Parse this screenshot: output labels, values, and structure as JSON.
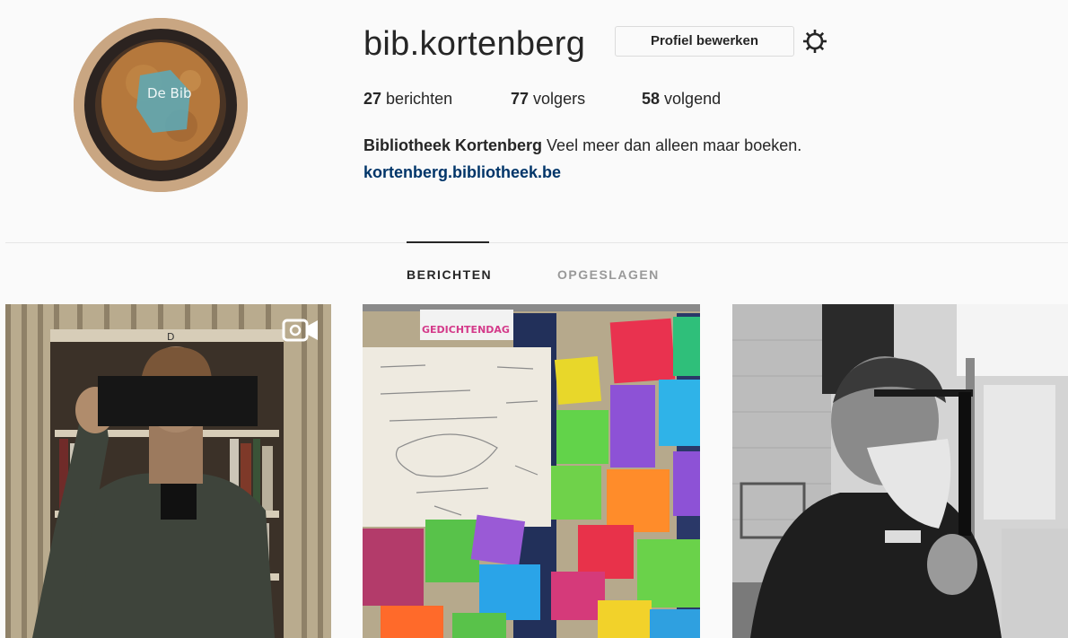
{
  "profile": {
    "username": "bib.kortenberg",
    "edit_button_label": "Profiel bewerken",
    "settings_icon": "gear-icon",
    "avatar_icon": "avatar",
    "avatar_text": "De Bib"
  },
  "stats": {
    "posts_count": "27",
    "posts_label": "berichten",
    "followers_count": "77",
    "followers_label": "volgers",
    "following_count": "58",
    "following_label": "volgend"
  },
  "bio": {
    "full_name": "Bibliotheek Kortenberg",
    "text": "Veel meer dan alleen maar boeken.",
    "link": "kortenberg.bibliotheek.be"
  },
  "tabs": [
    {
      "label": "BERICHTEN",
      "active": true
    },
    {
      "label": "OPGESLAGEN",
      "active": false
    }
  ],
  "posts": [
    {
      "kind": "video",
      "badge_icon": "video-camera-icon",
      "shelf_letter": "D"
    },
    {
      "kind": "photo",
      "banner_text": "GEDICHTENDAG"
    },
    {
      "kind": "photo"
    }
  ],
  "colors": {
    "link": "#003569",
    "text": "#262626",
    "muted": "#999999",
    "border": "#dbdbdb",
    "background": "#fafafa"
  }
}
